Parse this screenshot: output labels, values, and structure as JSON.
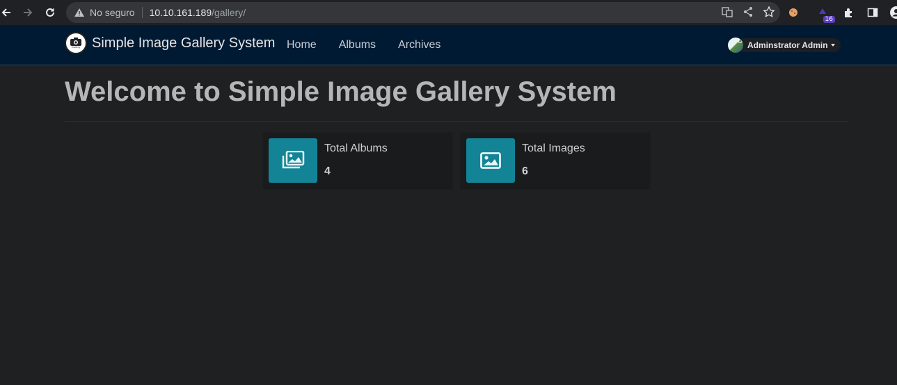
{
  "browser": {
    "security_label": "No seguro",
    "url_host": "10.10.161.189",
    "url_path": "/gallery/",
    "extension_badge": "16"
  },
  "navbar": {
    "brand_name": "Simple Image Gallery System",
    "brand_logo_text": "Gallery",
    "links": [
      "Home",
      "Albums",
      "Archives"
    ],
    "user_avatar_alt": "U",
    "user_name": "Adminstrator Admin"
  },
  "main": {
    "title": "Welcome to Simple Image Gallery System",
    "cards": [
      {
        "label": "Total Albums",
        "value": "4",
        "icon": "images-icon"
      },
      {
        "label": "Total Images",
        "value": "6",
        "icon": "image-icon"
      }
    ]
  },
  "colors": {
    "navbar_bg": "#001a33",
    "page_bg": "#1f2022",
    "card_icon_bg": "#138496"
  }
}
